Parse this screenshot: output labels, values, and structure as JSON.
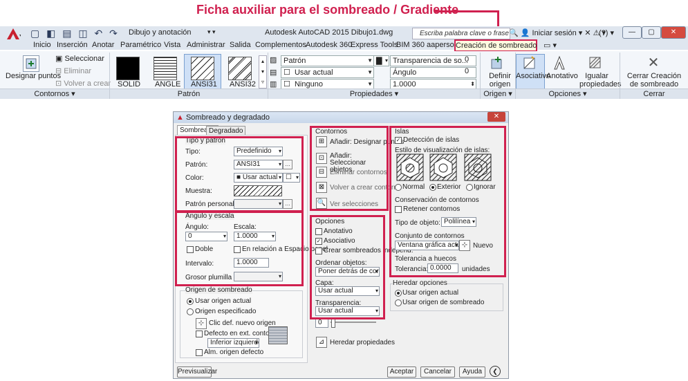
{
  "annotation": "Ficha auxiliar para el sombreado / Gradiente",
  "titlebar": {
    "workspace": "Dibujo y anotación",
    "app_title": "Autodesk AutoCAD 2015   Dibujo1.dwg",
    "search_placeholder": "Escriba palabra clave o frase",
    "sign_in": "Iniciar sesión",
    "help": "?"
  },
  "tabs": [
    "Inicio",
    "Inserción",
    "Anotar",
    "Paramétrico",
    "Vista",
    "Administrar",
    "Salida",
    "Complementos",
    "Autodesk 360",
    "Express Tools",
    "BIM 360",
    "aapersona"
  ],
  "active_tab": "Creación de sombreado",
  "ribbon": {
    "designar_puntos": "Designar puntos",
    "seleccionar": "Seleccionar",
    "eliminar": "Eliminar",
    "volver_a_crear": "Volver a crear",
    "patterns": [
      "SOLID",
      "ANGLE",
      "ANSI31",
      "ANSI32"
    ],
    "patron": "Patrón",
    "usar_actual": "Usar actual",
    "ninguno": "Ninguno",
    "transparencia": "Transparencia de so...",
    "transparencia_val": "0",
    "angulo": "Ángulo",
    "angulo_val": "0",
    "escala_val": "1.0000",
    "definir_origen": "Definir origen",
    "asociativo": "Asociativo",
    "anotativo": "Anotativo",
    "igualar_propiedades": "Igualar propiedades",
    "cerrar": "Cerrar Creación de sombreado",
    "panels": {
      "contornos": "Contornos ▾",
      "patron": "Patrón",
      "propiedades": "Propiedades ▾",
      "origen": "Origen ▾",
      "opciones": "Opciones ▾",
      "cerrar": "Cerrar"
    }
  },
  "dialog": {
    "title": "Sombreado y degradado",
    "tab_sombreado": "Sombreado",
    "tab_degradado": "Degradado",
    "tipo_patron": {
      "group": "Tipo y patrón",
      "tipo": "Tipo:",
      "tipo_val": "Predefinido",
      "patron": "Patrón:",
      "patron_val": "ANSI31",
      "color": "Color:",
      "color_val": "Usar actual",
      "muestra": "Muestra:",
      "patron_personalizado": "Patrón personalizado:"
    },
    "angulo_escala": {
      "group": "Ángulo y escala",
      "angulo": "Ángulo:",
      "angulo_val": "0",
      "escala": "Escala:",
      "escala_val": "1.0000",
      "doble": "Doble",
      "relacion": "En relación a Espacio papel",
      "intervalo": "Intervalo:",
      "intervalo_val": "1.0000",
      "grosor": "Grosor plumilla ISO:"
    },
    "origen": {
      "group": "Origen de sombreado",
      "usar_origen": "Usar origen actual",
      "origen_especificado": "Origen especificado",
      "clic": "Clic def. nuevo origen",
      "defecto": "Defecto en ext. contornos",
      "inferior": "Inferior izquierdo",
      "alm": "Alm. origen defecto"
    },
    "contornos": {
      "group": "Contornos",
      "anadir_puntos": "Añadir: Designar puntos",
      "anadir_objetos": "Añadir: Seleccionar objetos",
      "eliminar": "Eliminar contornos",
      "volver": "Volver a crear contorno",
      "ver": "Ver selecciones"
    },
    "opciones": {
      "group": "Opciones",
      "anotativo": "Anotativo",
      "asociativo": "Asociativo",
      "crear": "Crear sombreados independ.",
      "ordenar": "Ordenar objetos:",
      "ordenar_val": "Poner detrás de contorno",
      "capa": "Capa:",
      "capa_val": "Usar actual",
      "transparencia": "Transparencia:",
      "transparencia_val": "Usar actual",
      "slider_val": "0",
      "heredar": "Heredar propiedades"
    },
    "islas": {
      "group": "Islas",
      "deteccion": "Detección de islas",
      "estilo": "Estilo de visualización de islas:",
      "normal": "Normal",
      "exterior": "Exterior",
      "ignorar": "Ignorar"
    },
    "conservacion": {
      "group": "Conservación de contornos",
      "retener": "Retener contornos",
      "tipo": "Tipo de objeto:",
      "tipo_val": "Polilínea"
    },
    "conjunto": {
      "group": "Conjunto de contornos",
      "val": "Ventana gráfica actual",
      "nuevo": "Nuevo"
    },
    "tolerancia": {
      "group": "Tolerancia a huecos",
      "label": "Tolerancia:",
      "val": "0.0000",
      "unit": "unidades"
    },
    "heredar": {
      "group": "Heredar opciones",
      "usar_actual": "Usar origen actual",
      "usar_sombreado": "Usar origen de sombreado"
    },
    "buttons": {
      "previsualizar": "Previsualizar",
      "aceptar": "Aceptar",
      "cancelar": "Cancelar",
      "ayuda": "Ayuda"
    }
  },
  "colors": {
    "highlight": "#d0204f"
  }
}
